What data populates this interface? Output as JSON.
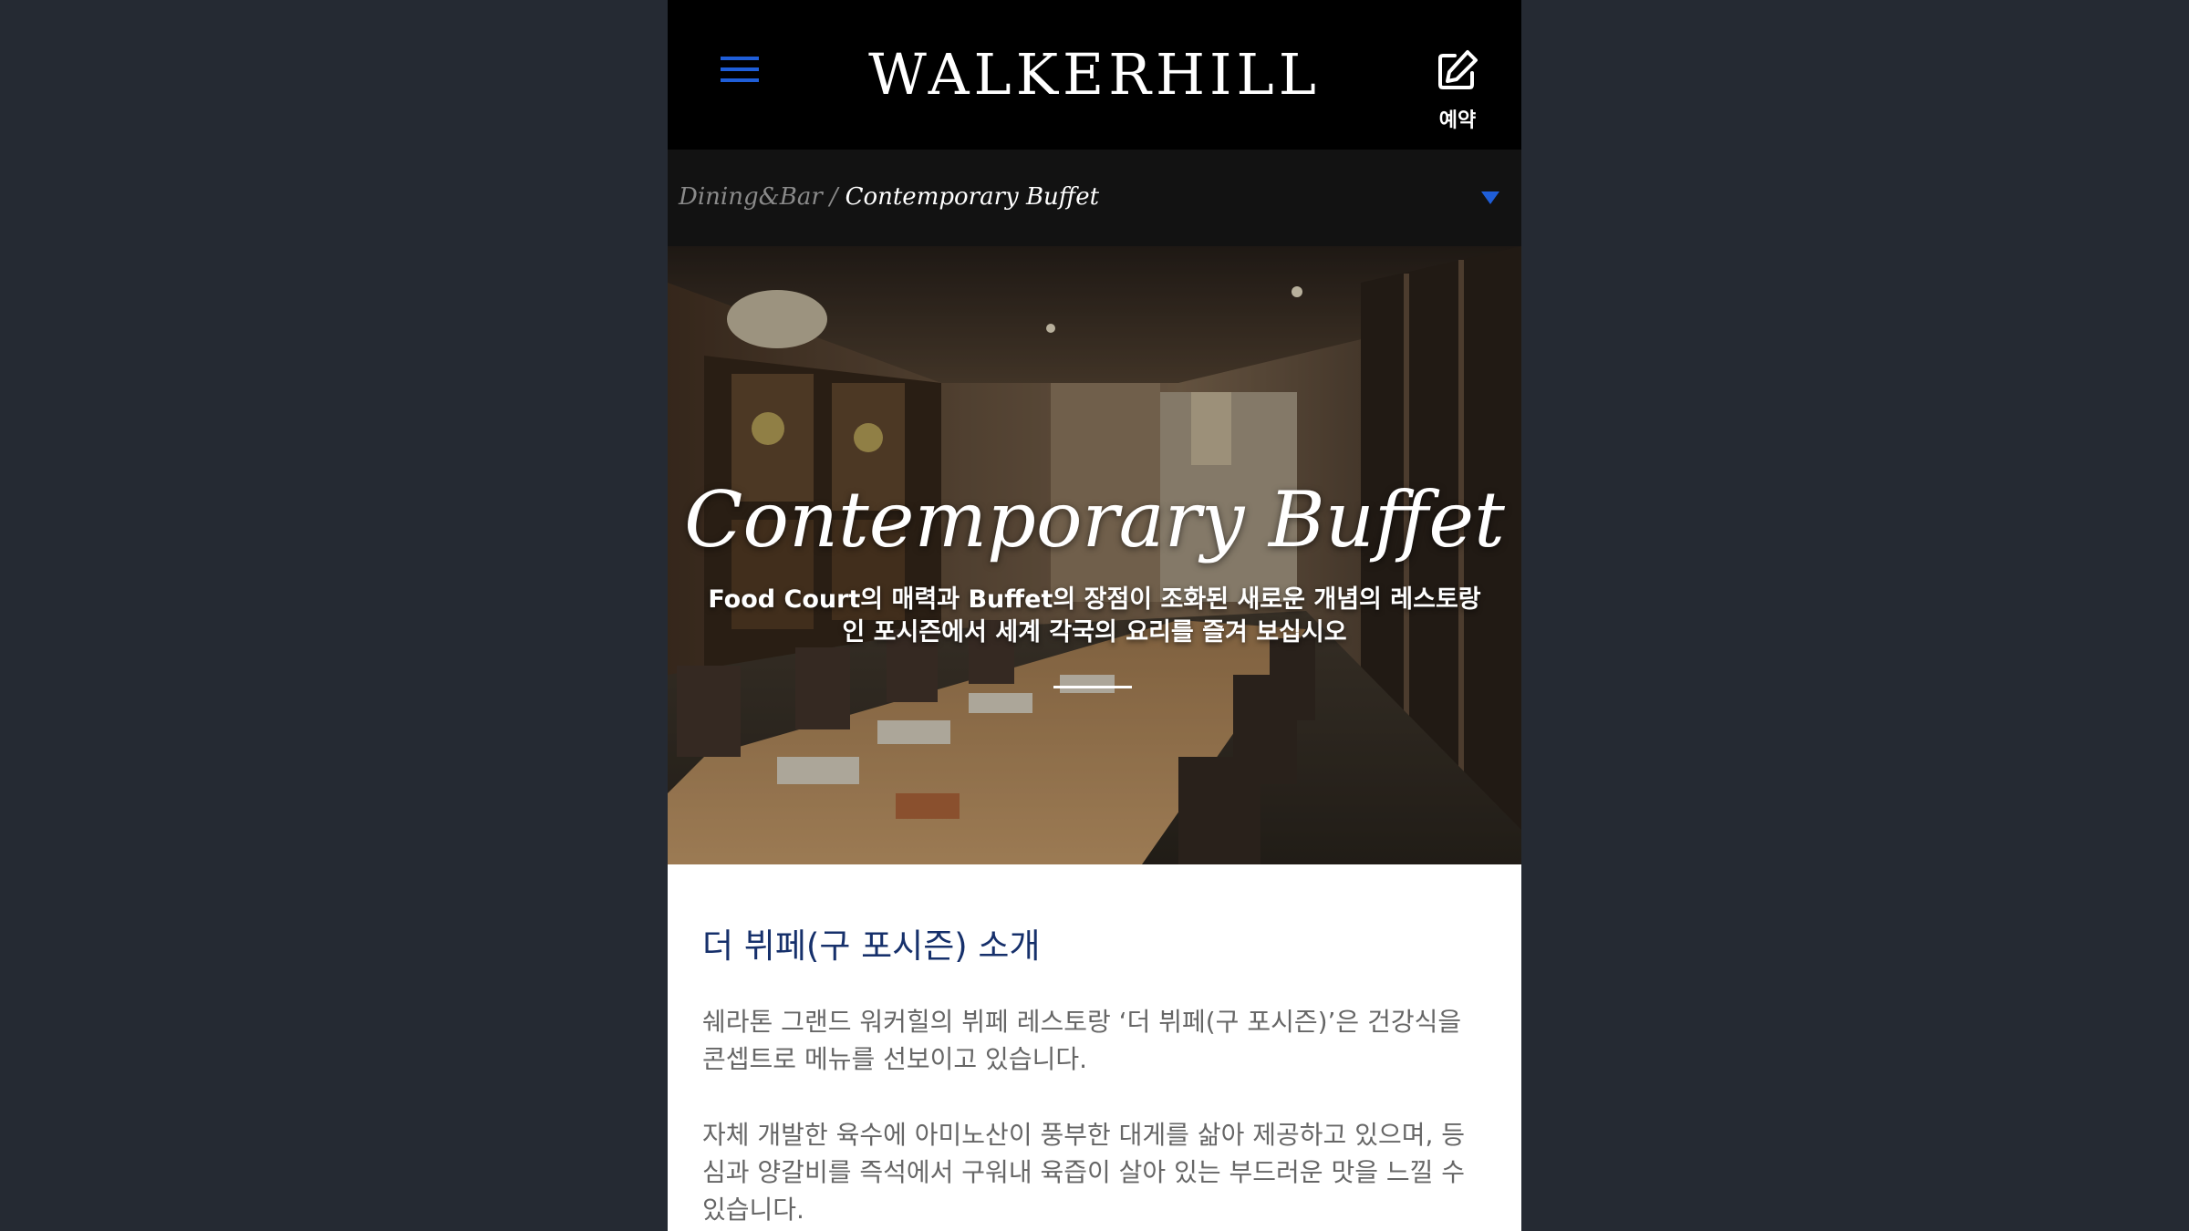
{
  "header": {
    "brand": "WALKERHILL",
    "reserve_label": "예약",
    "menu_icon": "hamburger-menu-icon",
    "reserve_icon": "edit-icon",
    "accent_color": "#1f5ed8"
  },
  "breadcrumb": {
    "parent": "Dining&Bar",
    "separator": "/",
    "current": "Contemporary Buffet",
    "toggle_icon": "caret-down-icon"
  },
  "hero": {
    "title": "Contemporary Buffet",
    "description": "Food Court의 매력과 Buffet의 장점이 조화된 새로운 개념의 레스토랑인 포시즌에서 세계 각국의 요리를 즐겨 보십시오"
  },
  "intro": {
    "heading": "더 뷔페(구 포시즌) 소개",
    "paragraph1": "쉐라톤 그랜드 워커힐의 뷔페 레스토랑 ‘더 뷔페(구 포시즌)’은 건강식을 콘셉트로 메뉴를 선보이고 있습니다.",
    "paragraph2": "자체 개발한 육수에 아미노산이 풍부한 대게를 삶아 제공하고 있으며, 등심과 양갈비를 즉석에서 구워내 육즙이 살아 있는 부드러운 맛을 느낄 수 있습니다.",
    "heading_color": "#16306b"
  }
}
